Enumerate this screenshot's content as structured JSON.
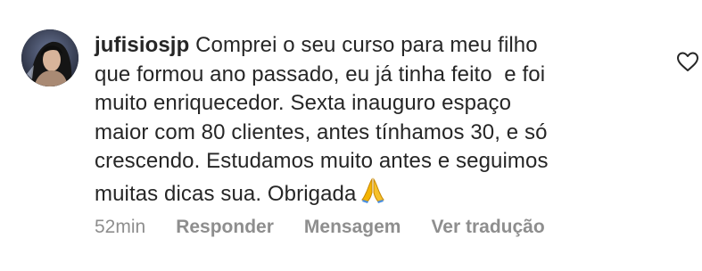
{
  "comment": {
    "username": "jufisiosjp",
    "lines": [
      "Comprei o seu curso para meu filho",
      "que formou ano passado, eu já tinha feito  e foi",
      "muito enriquecedor. Sexta inauguro espaço",
      "maior com 80 clientes, antes tínhamos 30, e só",
      "crescendo. Estudamos muito antes e seguimos",
      "muitas dicas sua. Obrigada"
    ],
    "emoji": "folded-hands-emoji",
    "time": "52min",
    "actions": {
      "reply": "Responder",
      "message": "Mensagem",
      "translate": "Ver tradução"
    }
  },
  "icons": {
    "like": "heart-outline-icon",
    "avatar": "user-avatar"
  },
  "colors": {
    "text": "#262626",
    "muted": "#8e8e8e",
    "emoji": "#f4b400"
  }
}
